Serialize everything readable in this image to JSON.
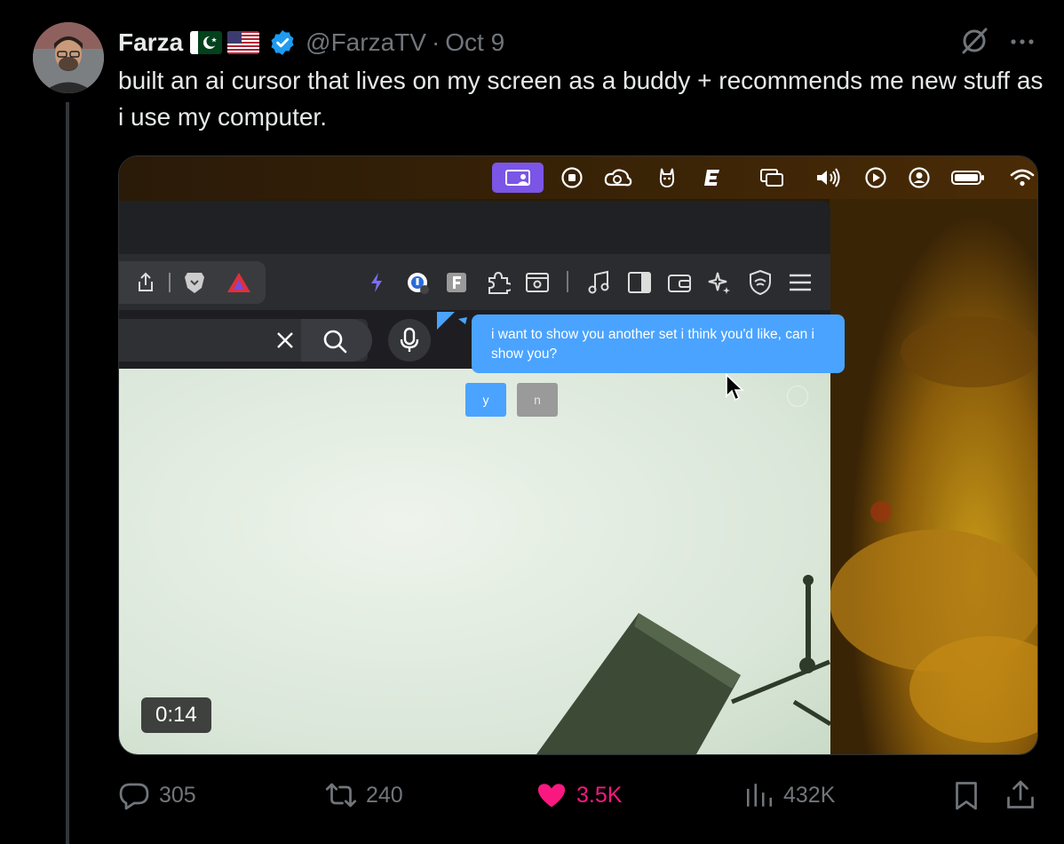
{
  "author": {
    "name": "Farza",
    "flags": [
      "pakistan-flag",
      "usa-flag"
    ],
    "verified": true,
    "handle": "@FarzaTV",
    "separator": "·",
    "date": "Oct 9"
  },
  "tweet": {
    "text": "built an ai cursor that lives on my screen as a buddy + recommends me new stuff as i use my computer."
  },
  "media": {
    "timestamp": "0:14",
    "menubar_icons": [
      "screen-share-icon",
      "stop-icon",
      "creative-cloud-icon",
      "llama-icon",
      "bold-e-icon",
      "windows-icon",
      "volume-icon",
      "play-icon",
      "user-circle-icon",
      "battery-icon",
      "wifi-icon"
    ],
    "browser_icons": [
      "share-icon",
      "brave-lion-icon",
      "triangle-alert-icon",
      "lightning-icon",
      "privacy-badge-icon",
      "f-extension-icon",
      "puzzle-icon",
      "reader-icon",
      "music-icon",
      "sidebar-icon",
      "wallet-icon",
      "sparkle-icon",
      "shield-icon",
      "menu-icon"
    ],
    "assistant_message": "i want to show you another set i think you'd like, can i show you?",
    "yes_label": "y",
    "no_label": "n",
    "accent_color": "#4aa3ff"
  },
  "actions": {
    "replies": "305",
    "reposts": "240",
    "likes": "3.5K",
    "views": "432K",
    "like_color": "#f91880"
  }
}
